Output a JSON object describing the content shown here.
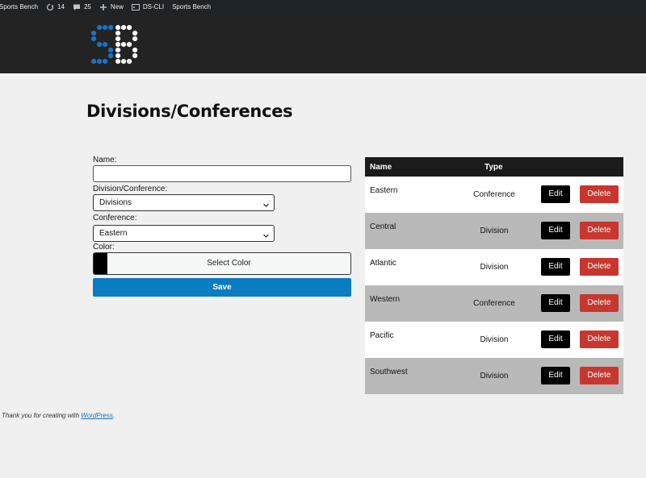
{
  "admin_bar": {
    "site_name": "Sports Bench",
    "updates_count": "14",
    "comments_count": "25",
    "new_label": "New",
    "dscli_label": "DS-CLI",
    "site_link": "Sports Bench"
  },
  "header": {
    "logo_icon": "sports-bench-logo",
    "logo_colors": {
      "s": "#1a73c8",
      "b": "#ffffff"
    }
  },
  "page": {
    "title": "Divisions/Conferences"
  },
  "form": {
    "name_label": "Name:",
    "name_value": "",
    "type_label": "Division/Conference:",
    "type_value": "Divisions",
    "conference_label": "Conference:",
    "conference_value": "Eastern",
    "color_label": "Color:",
    "color_swatch": "#000000",
    "select_color_label": "Select Color",
    "save_label": "Save"
  },
  "table": {
    "headers": {
      "name": "Name",
      "type": "Type"
    },
    "edit_label": "Edit",
    "delete_label": "Delete",
    "rows": [
      {
        "name": "Eastern",
        "type": "Conference"
      },
      {
        "name": "Central",
        "type": "Division"
      },
      {
        "name": "Atlantic",
        "type": "Division"
      },
      {
        "name": "Western",
        "type": "Conference"
      },
      {
        "name": "Pacific",
        "type": "Division"
      },
      {
        "name": "Southwest",
        "type": "Division"
      }
    ]
  },
  "footer": {
    "text": "Thank you for creating with ",
    "link": "WordPress",
    "suffix": "."
  },
  "colors": {
    "save_button": "#0a7cc1",
    "delete_button": "#c7372f",
    "header_bg": "#232323",
    "admin_bar_bg": "#1d2327"
  }
}
